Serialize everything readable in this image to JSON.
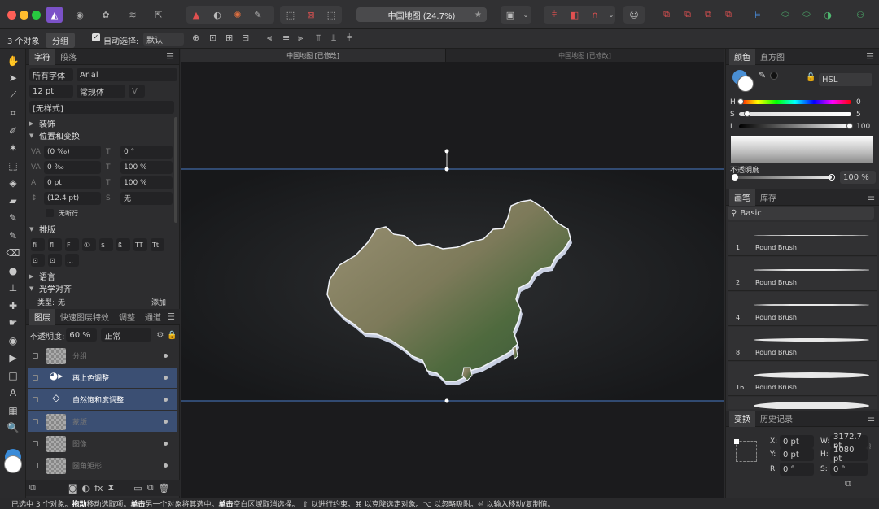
{
  "titlebar": {
    "document_title": "中国地图 (24.7%)",
    "star": "★"
  },
  "contextbar": {
    "selection_count": "3 个对象",
    "group_button": "分组",
    "auto_select_label": "自动选择:",
    "auto_select_value": "默认"
  },
  "character_panel": {
    "tabs": [
      "字符",
      "段落"
    ],
    "font_collection": "所有字体",
    "font_family": "Arial",
    "font_size": "12 pt",
    "font_style": "常规体",
    "font_style_extra": "V",
    "style": "[无样式]",
    "sections": {
      "decoration": "装饰",
      "position_transform": "位置和变换",
      "typography": "排版",
      "language": "语言",
      "optical_align": "光学对齐"
    },
    "fields": {
      "kerning": "(0 ‰)",
      "skew": "0 °",
      "tracking": "0 ‰",
      "hscale": "100 %",
      "baseline": "0 pt",
      "vscale": "100 %",
      "leading": "(12.4 pt)",
      "subscript": "无"
    },
    "no_break": "无断行",
    "type_label": "类型:",
    "type_value": "无",
    "add_button": "添加",
    "typo_buttons": [
      "fi",
      "ﬂ",
      "F",
      "①",
      "$",
      "ß",
      "TT",
      "Tt",
      "⊡",
      "⊡",
      "…"
    ]
  },
  "layers_panel": {
    "tabs": [
      "图层",
      "快速图层特效",
      "调整",
      "通道"
    ],
    "opacity_label": "不透明度:",
    "opacity_value": "60 %",
    "blend_mode": "正常",
    "layers": [
      {
        "name": "分组",
        "selected": false,
        "dim": true
      },
      {
        "name": "再上色调整",
        "selected": true,
        "dim": false
      },
      {
        "name": "自然饱和度调整",
        "selected": true,
        "dim": false
      },
      {
        "name": "蒙版",
        "selected": true,
        "dim": true
      },
      {
        "name": "图像",
        "selected": false,
        "dim": true
      },
      {
        "name": "圆角矩形",
        "selected": false,
        "dim": true
      }
    ]
  },
  "canvas": {
    "tabs": [
      "中国地图 [已修改]",
      "中国地图 [已修改]"
    ]
  },
  "color_panel": {
    "tabs": [
      "颜色",
      "直方图"
    ],
    "model": "HSL",
    "h_label": "H",
    "h_value": "0",
    "s_label": "S",
    "s_value": "5",
    "l_label": "L",
    "l_value": "100",
    "opacity_label": "不透明度",
    "opacity_value": "100 %"
  },
  "brushes_panel": {
    "tabs": [
      "画笔",
      "库存"
    ],
    "category": "Basic",
    "brushes": [
      {
        "size": "1",
        "name": "Round Brush"
      },
      {
        "size": "2",
        "name": "Round Brush"
      },
      {
        "size": "4",
        "name": "Round Brush"
      },
      {
        "size": "8",
        "name": "Round Brush"
      },
      {
        "size": "16",
        "name": "Round Brush"
      }
    ]
  },
  "transform_panel": {
    "tabs": [
      "变换",
      "历史记录"
    ],
    "x_label": "X:",
    "x_value": "0 pt",
    "y_label": "Y:",
    "y_value": "0 pt",
    "w_label": "W:",
    "w_value": "3172.7 pt",
    "h_label": "H:",
    "h_value": "1080 pt",
    "r_label": "R:",
    "r_value": "0 °",
    "s_label": "S:",
    "s_value": "0 °"
  },
  "statusbar": {
    "p1": "已选中 3 个对象。",
    "b1": "拖动",
    "p2": "移动选取项。",
    "b2": "单击",
    "p3": "另一个对象将其选中。",
    "b3": "单击",
    "p4": "空白区域取消选择。",
    "p5": "⇧ 以进行约束。⌘ 以克隆选定对象。⌥ 以忽略吸附。⏎ 以输入移动/复制值。"
  },
  "colors": {
    "accent": "#3b4f73",
    "canvas": "#1b1b1d",
    "panel": "#2d2d2f"
  }
}
